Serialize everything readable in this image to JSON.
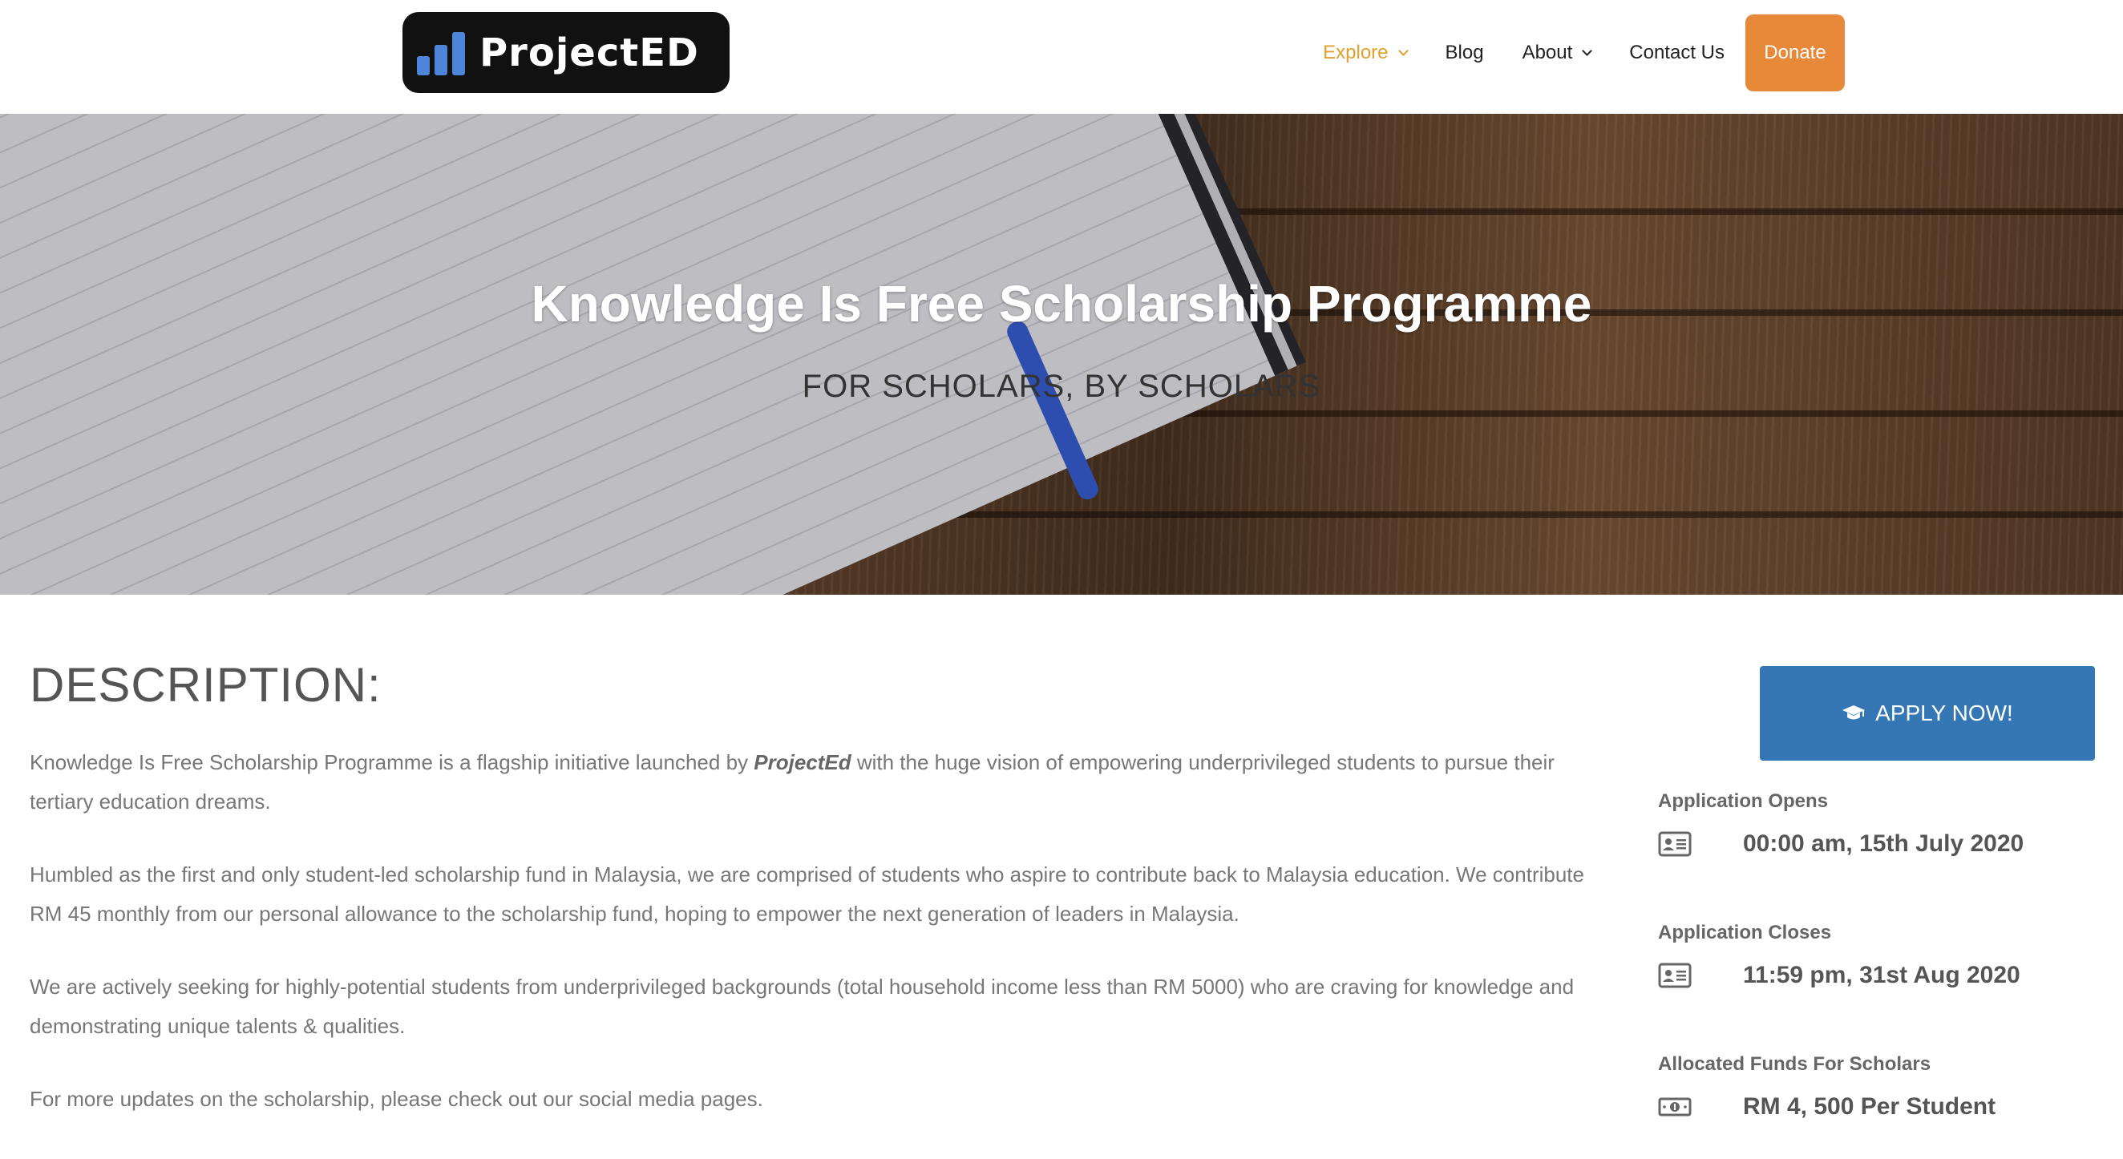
{
  "header": {
    "logo_text": "ProjectED",
    "nav": [
      {
        "label": "Explore"
      },
      {
        "label": "Blog"
      },
      {
        "label": "About"
      },
      {
        "label": "Contact Us"
      }
    ],
    "donate_label": "Donate"
  },
  "hero": {
    "title": "Knowledge Is Free Scholarship Programme",
    "subtitle": "FOR SCHOLARS, BY SCHOLARS"
  },
  "description": {
    "heading": "DESCRIPTION:",
    "p1_before": "Knowledge Is Free Scholarship Programme is a flagship initiative launched by ",
    "p1_brand": "ProjectEd",
    "p1_after": " with the huge vision of empowering underprivileged students to pursue their tertiary education dreams.",
    "p2": "Humbled as the first and only student-led scholarship fund in Malaysia, we are comprised of students who aspire to contribute back to Malaysia education. We contribute RM 45 monthly from our personal allowance to the scholarship fund, hoping to empower the next generation of leaders in Malaysia.",
    "p3": "We are actively seeking for highly-potential students from underprivileged backgrounds (total household income less than RM 5000) who are craving for knowledge and demonstrating unique talents & qualities.",
    "p4": "For more updates on the scholarship, please check out our social media pages."
  },
  "sidebar": {
    "apply_label": "APPLY NOW!",
    "items": [
      {
        "label": "Application Opens",
        "value": "00:00 am, 15th July 2020",
        "icon": "id-card-icon"
      },
      {
        "label": "Application Closes",
        "value": "11:59 pm, 31st Aug 2020",
        "icon": "id-card-icon"
      },
      {
        "label": "Allocated Funds For Scholars",
        "value": "RM 4, 500 Per Student",
        "icon": "money-bill-icon"
      }
    ]
  },
  "colors": {
    "accent_orange": "#e8893a",
    "nav_active": "#e0a02e",
    "apply_blue": "#3577b5"
  }
}
